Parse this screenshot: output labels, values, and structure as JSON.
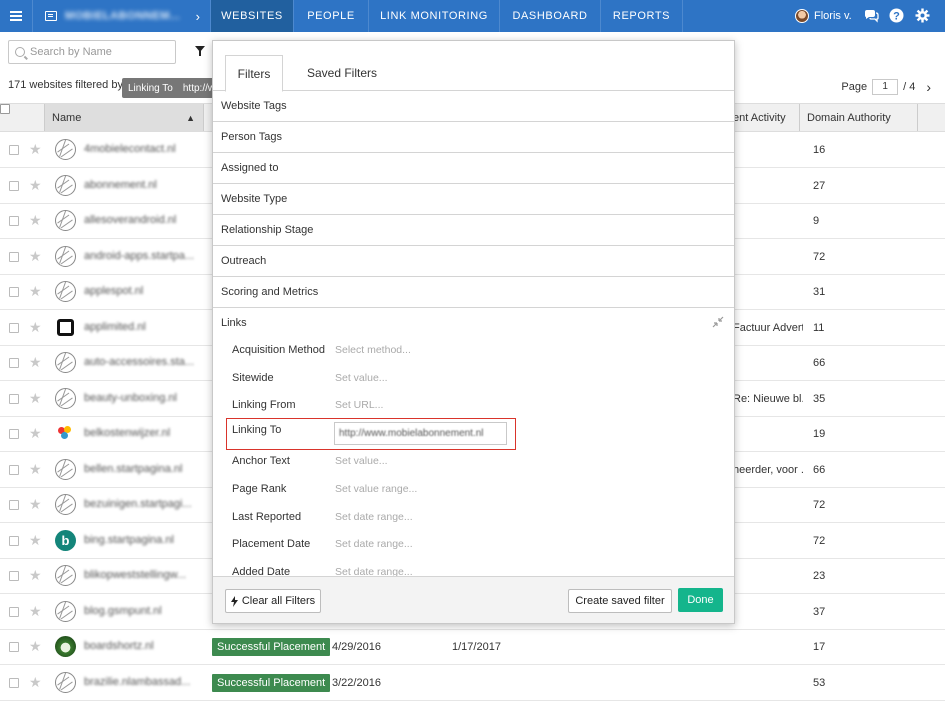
{
  "nav": {
    "app_name": "MOBIELABONNEM...",
    "tabs": [
      {
        "label": "WEBSITES",
        "active": true
      },
      {
        "label": "PEOPLE",
        "active": false
      },
      {
        "label": "LINK MONITORING",
        "active": false
      },
      {
        "label": "DASHBOARD",
        "active": false
      },
      {
        "label": "REPORTS",
        "active": false
      }
    ],
    "user_name": "Floris v.",
    "icons": [
      "hamburger-icon",
      "list-icon",
      "chevron-right-icon",
      "chat-icon",
      "help-icon",
      "gear-icon"
    ]
  },
  "toolbar": {
    "search_placeholder": "Search by Name",
    "filtered_count": "171 websites filtered by:",
    "chip_label": "Linking To",
    "chip_value": "http://w...",
    "page_label": "Page",
    "page_current": "1",
    "page_total": "/ 4"
  },
  "table": {
    "columns": {
      "name": "Name",
      "activity": "ent Activity",
      "domain_authority": "Domain Authority"
    },
    "rows": [
      {
        "site": "4mobielecontact.nl",
        "favicon": "globe",
        "activity": "",
        "da": "16"
      },
      {
        "site": "abonnement.nl",
        "favicon": "globe",
        "activity": "",
        "da": "27"
      },
      {
        "site": "allesoverandroid.nl",
        "favicon": "globe",
        "activity": "",
        "da": "9"
      },
      {
        "site": "android-apps.startpa...",
        "favicon": "globe",
        "activity": "",
        "da": "72"
      },
      {
        "site": "applespot.nl",
        "favicon": "globe",
        "activity": "",
        "da": "31"
      },
      {
        "site": "applimited.nl",
        "favicon": "square",
        "activity": "Factuur Advert...",
        "da": "11"
      },
      {
        "site": "auto-accessoires.sta...",
        "favicon": "globe",
        "activity": "",
        "da": "66"
      },
      {
        "site": "beauty-unboxing.nl",
        "favicon": "globe",
        "activity": "Re: Nieuwe bl...",
        "da": "35"
      },
      {
        "site": "belkostenwijzer.nl",
        "favicon": "dots",
        "activity": "",
        "da": "19"
      },
      {
        "site": "bellen.startpagina.nl",
        "favicon": "globe",
        "activity": "heerder, voor ...",
        "da": "66"
      },
      {
        "site": "bezuinigen.startpagi...",
        "favicon": "globe",
        "activity": "",
        "da": "72"
      },
      {
        "site": "bing.startpagina.nl",
        "favicon": "bing",
        "activity": "",
        "da": "72"
      },
      {
        "site": "blikopweststellingw...",
        "favicon": "globe",
        "activity": "",
        "da": "23"
      },
      {
        "site": "blog.gsmpunt.nl",
        "favicon": "globe",
        "activity": "",
        "da": "37"
      },
      {
        "site": "boardshortz.nl",
        "favicon": "avatar",
        "activity": "",
        "da": "17",
        "status": "Successful Placement",
        "date1": "4/29/2016",
        "date2": "1/17/2017"
      },
      {
        "site": "brazilie.nlambassad...",
        "favicon": "globe",
        "activity": "",
        "da": "53",
        "status": "Successful Placement",
        "date1": "3/22/2016",
        "date2": ""
      }
    ]
  },
  "filter_panel": {
    "tabs": {
      "filters": "Filters",
      "saved": "Saved Filters"
    },
    "sections": [
      "Website Tags",
      "Person Tags",
      "Assigned to",
      "Website Type",
      "Relationship Stage",
      "Outreach",
      "Scoring and Metrics",
      "Links"
    ],
    "link_fields": [
      {
        "label": "Acquisition Method",
        "placeholder": "Select method..."
      },
      {
        "label": "Sitewide",
        "placeholder": "Set value..."
      },
      {
        "label": "Linking From",
        "placeholder": "Set URL..."
      },
      {
        "label": "Linking To",
        "value": "http://www.mobielabonnement.nl"
      },
      {
        "label": "Anchor Text",
        "placeholder": "Set value..."
      },
      {
        "label": "Page Rank",
        "placeholder": "Set value range..."
      },
      {
        "label": "Last Reported",
        "placeholder": "Set date range..."
      },
      {
        "label": "Placement Date",
        "placeholder": "Set date range..."
      },
      {
        "label": "Added Date",
        "placeholder": "Set date range..."
      }
    ],
    "buttons": {
      "clear": "Clear all Filters",
      "save": "Create saved filter",
      "done": "Done"
    },
    "colors": {
      "done": "#14b58c",
      "highlight": "#d9342b",
      "nav": "#2e74c5",
      "status": "#3d8a4f"
    }
  }
}
